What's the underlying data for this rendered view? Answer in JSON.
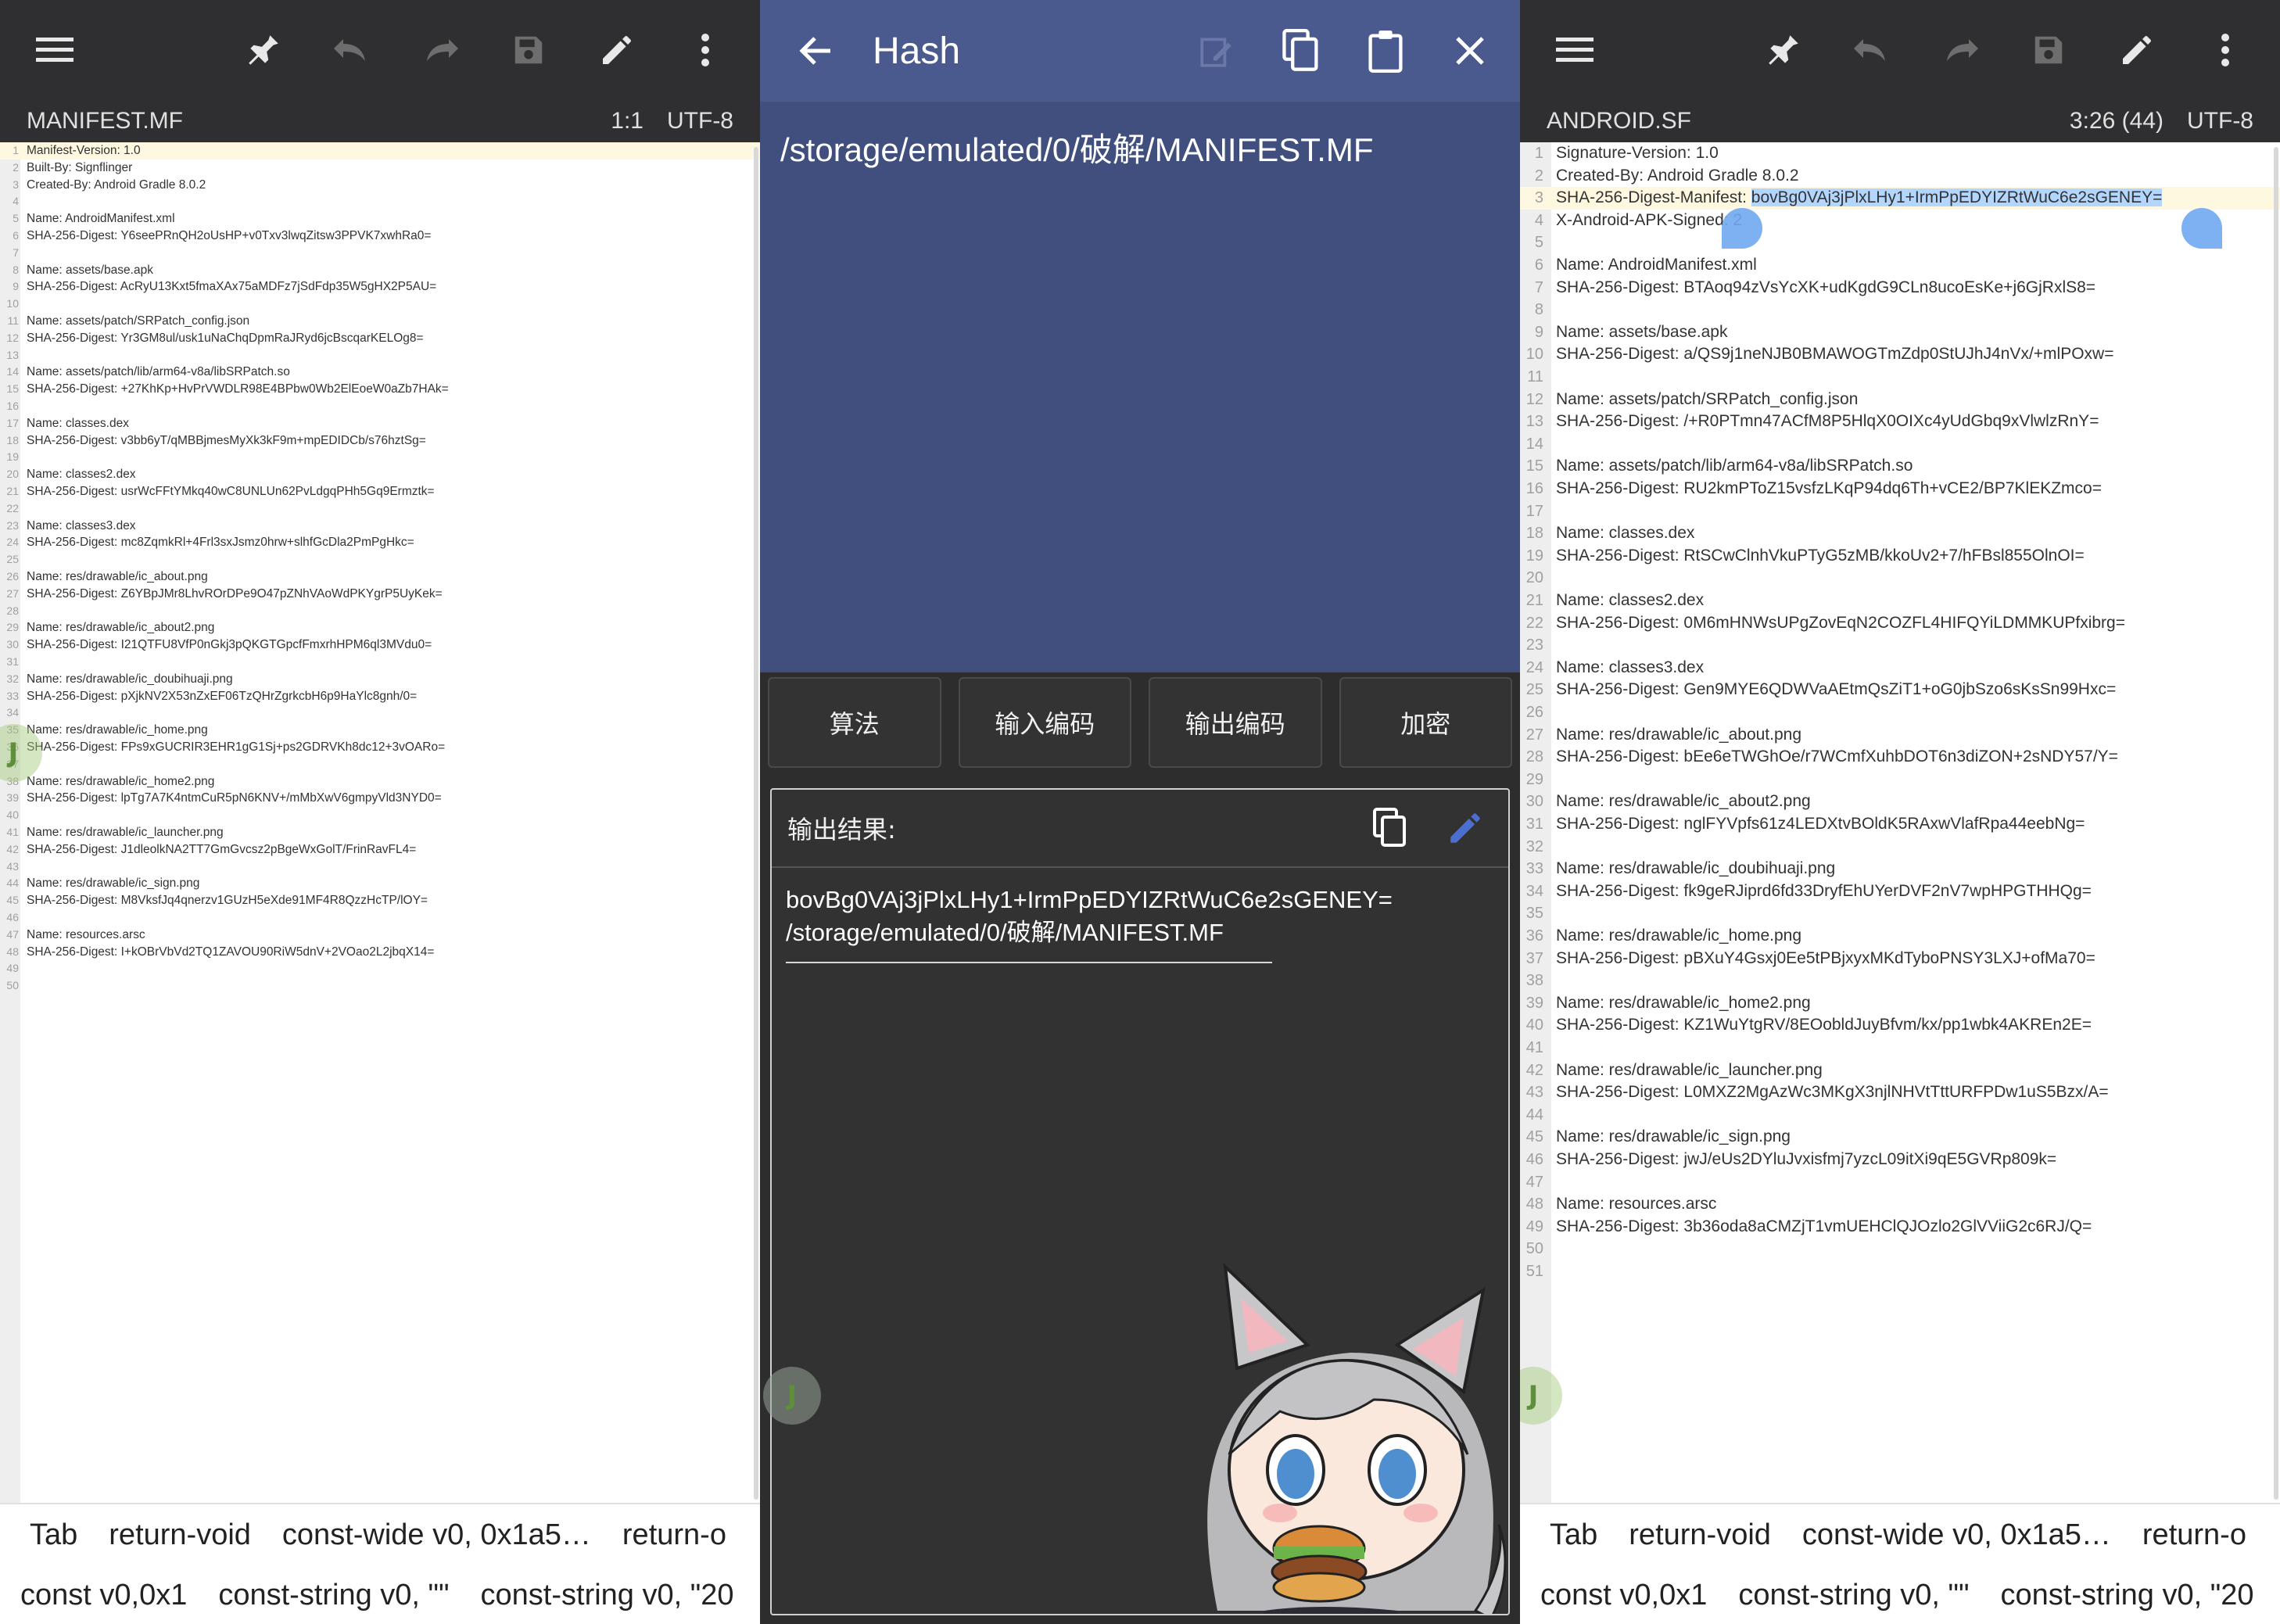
{
  "left_editor": {
    "filename": "MANIFEST.MF",
    "cursor": "1:1",
    "encoding": "UTF-8",
    "lines": [
      "Manifest-Version: 1.0",
      "Built-By: Signflinger",
      "Created-By: Android Gradle 8.0.2",
      "",
      "Name: AndroidManifest.xml",
      "SHA-256-Digest: Y6seePRnQH2oUsHP+v0Txv3lwqZitsw3PPVK7xwhRa0=",
      "",
      "Name: assets/base.apk",
      "SHA-256-Digest: AcRyU13Kxt5fmaXAx75aMDFz7jSdFdp35W5gHX2P5AU=",
      "",
      "Name: assets/patch/SRPatch_config.json",
      "SHA-256-Digest: Yr3GM8ul/usk1uNaChqDpmRaJRyd6jcBscqarKELOg8=",
      "",
      "Name: assets/patch/lib/arm64-v8a/libSRPatch.so",
      "SHA-256-Digest: +27KhKp+HvPrVWDLR98E4BPbw0Wb2ElEoeW0aZb7HAk=",
      "",
      "Name: classes.dex",
      "SHA-256-Digest: v3bb6yT/qMBBjmesMyXk3kF9m+mpEDIDCb/s76hztSg=",
      "",
      "Name: classes2.dex",
      "SHA-256-Digest: usrWcFFtYMkq40wC8UNLUn62PvLdgqPHh5Gq9Ermztk=",
      "",
      "Name: classes3.dex",
      "SHA-256-Digest: mc8ZqmkRl+4Frl3sxJsmz0hrw+slhfGcDla2PmPgHkc=",
      "",
      "Name: res/drawable/ic_about.png",
      "SHA-256-Digest: Z6YBpJMr8LhvROrDPe9O47pZNhVAoWdPKYgrP5UyKek=",
      "",
      "Name: res/drawable/ic_about2.png",
      "SHA-256-Digest: I21QTFU8VfP0nGkj3pQKGTGpcfFmxrhHPM6ql3MVdu0=",
      "",
      "Name: res/drawable/ic_doubihuaji.png",
      "SHA-256-Digest: pXjkNV2X53nZxEF06TzQHrZgrkcbH6p9HaYlc8gnh/0=",
      "",
      "Name: res/drawable/ic_home.png",
      "SHA-256-Digest: FPs9xGUCRIR3EHR1gG1Sj+ps2GDRVKh8dc12+3vOARo=",
      "",
      "Name: res/drawable/ic_home2.png",
      "SHA-256-Digest: lpTg7A7K4ntmCuR5pN6KNV+/mMbXwV6gmpyVld3NYD0=",
      "",
      "Name: res/drawable/ic_launcher.png",
      "SHA-256-Digest: J1dleolkNA2TT7GmGvcsz2pBgeWxGolT/FrinRavFL4=",
      "",
      "Name: res/drawable/ic_sign.png",
      "SHA-256-Digest: M8VksfJq4qnerzv1GUzH5eXde91MF4R8QzzHcTP/lOY=",
      "",
      "Name: resources.arsc",
      "SHA-256-Digest: I+kOBrVbVd2TQ1ZAVOU90RiW5dnV+2VOao2L2jbqX14=",
      "",
      ""
    ]
  },
  "right_editor": {
    "filename": "ANDROID.SF",
    "cursor": "3:26 (44)",
    "encoding": "UTF-8",
    "selected_prefix": "SHA-256-Digest-Manifest: ",
    "selected_text": "bovBg0VAj3jPlxLHy1+IrmPpEDYIZRtWuC6e2sGENEY=",
    "lines": [
      "Signature-Version: 1.0",
      "Created-By: Android Gradle 8.0.2",
      "SHA-256-Digest-Manifest: bovBg0VAj3jPlxLHy1+IrmPpEDYIZRtWuC6e2sGENEY=",
      "X-Android-APK-Signed: 2",
      "",
      "Name: AndroidManifest.xml",
      "SHA-256-Digest: BTAoq94zVsYcXK+udKgdG9CLn8ucoEsKe+j6GjRxlS8=",
      "",
      "Name: assets/base.apk",
      "SHA-256-Digest: a/QS9j1neNJB0BMAWOGTmZdp0StUJhJ4nVx/+mlPOxw=",
      "",
      "Name: assets/patch/SRPatch_config.json",
      "SHA-256-Digest: /+R0PTmn47ACfM8P5HlqX0OIXc4yUdGbq9xVlwlzRnY=",
      "",
      "Name: assets/patch/lib/arm64-v8a/libSRPatch.so",
      "SHA-256-Digest: RU2kmPToZ15vsfzLKqP94dq6Th+vCE2/BP7KlEKZmco=",
      "",
      "Name: classes.dex",
      "SHA-256-Digest: RtSCwClnhVkuPTyG5zMB/kkoUv2+7/hFBsl855OlnOI=",
      "",
      "Name: classes2.dex",
      "SHA-256-Digest: 0M6mHNWsUPgZovEqN2COZFL4HIFQYiLDMMKUPfxibrg=",
      "",
      "Name: classes3.dex",
      "SHA-256-Digest: Gen9MYE6QDWVaAEtmQsZiT1+oG0jbSzo6sKsSn99Hxc=",
      "",
      "Name: res/drawable/ic_about.png",
      "SHA-256-Digest: bEe6eTWGhOe/r7WCmfXuhbDOT6n3diZON+2sNDY57/Y=",
      "",
      "Name: res/drawable/ic_about2.png",
      "SHA-256-Digest: nglFYVpfs61z4LEDXtvBOldK5RAxwVlafRpa44eebNg=",
      "",
      "Name: res/drawable/ic_doubihuaji.png",
      "SHA-256-Digest: fk9geRJiprd6fd33DryfEhUYerDVF2nV7wpHPGTHHQg=",
      "",
      "Name: res/drawable/ic_home.png",
      "SHA-256-Digest: pBXuY4Gsxj0Ee5tPBjxyxMKdTyboPNSY3LXJ+ofMa70=",
      "",
      "Name: res/drawable/ic_home2.png",
      "SHA-256-Digest: KZ1WuYtgRV/8EOobldJuyBfvm/kx/pp1wbk4AKREn2E=",
      "",
      "Name: res/drawable/ic_launcher.png",
      "SHA-256-Digest: L0MXZ2MgAzWc3MKgX3njlNHVtTttURFPDw1uS5Bzx/A=",
      "",
      "Name: res/drawable/ic_sign.png",
      "SHA-256-Digest: jwJ/eUs2DYluJvxisfmj7yzcL09itXi9qE5GVRp809k=",
      "",
      "Name: resources.arsc",
      "SHA-256-Digest: 3b36oda8aCMZjT1vmUEHClQJOzlo2GlVViiG2c6RJ/Q=",
      "",
      ""
    ]
  },
  "keyboard_bar": {
    "row1": [
      "Tab",
      "return-void",
      "const-wide v0, 0x1a5…",
      "return-o"
    ],
    "row2": [
      "const v0,0x1",
      "const-string v0, \"\"",
      "const-string v0, \"20"
    ]
  },
  "hash_dialog": {
    "title": "Hash",
    "input_path": "/storage/emulated/0/破解/MANIFEST.MF",
    "buttons": [
      "算法",
      "输入编码",
      "输出编码",
      "加密"
    ],
    "output_label": "输出结果:",
    "output_hash": "bovBg0VAj3jPlxLHy1+IrmPpEDYIZRtWuC6e2sGENEY=",
    "output_path": "/storage/emulated/0/破解/MANIFEST.MF"
  },
  "fab": {
    "label": "J"
  },
  "colors": {
    "toolbar": "#2f2f31",
    "appbar": "#4a5a8e",
    "input_bg": "#404f7d",
    "selection": "#b3d6ff",
    "accent": "#6fa9f0"
  }
}
